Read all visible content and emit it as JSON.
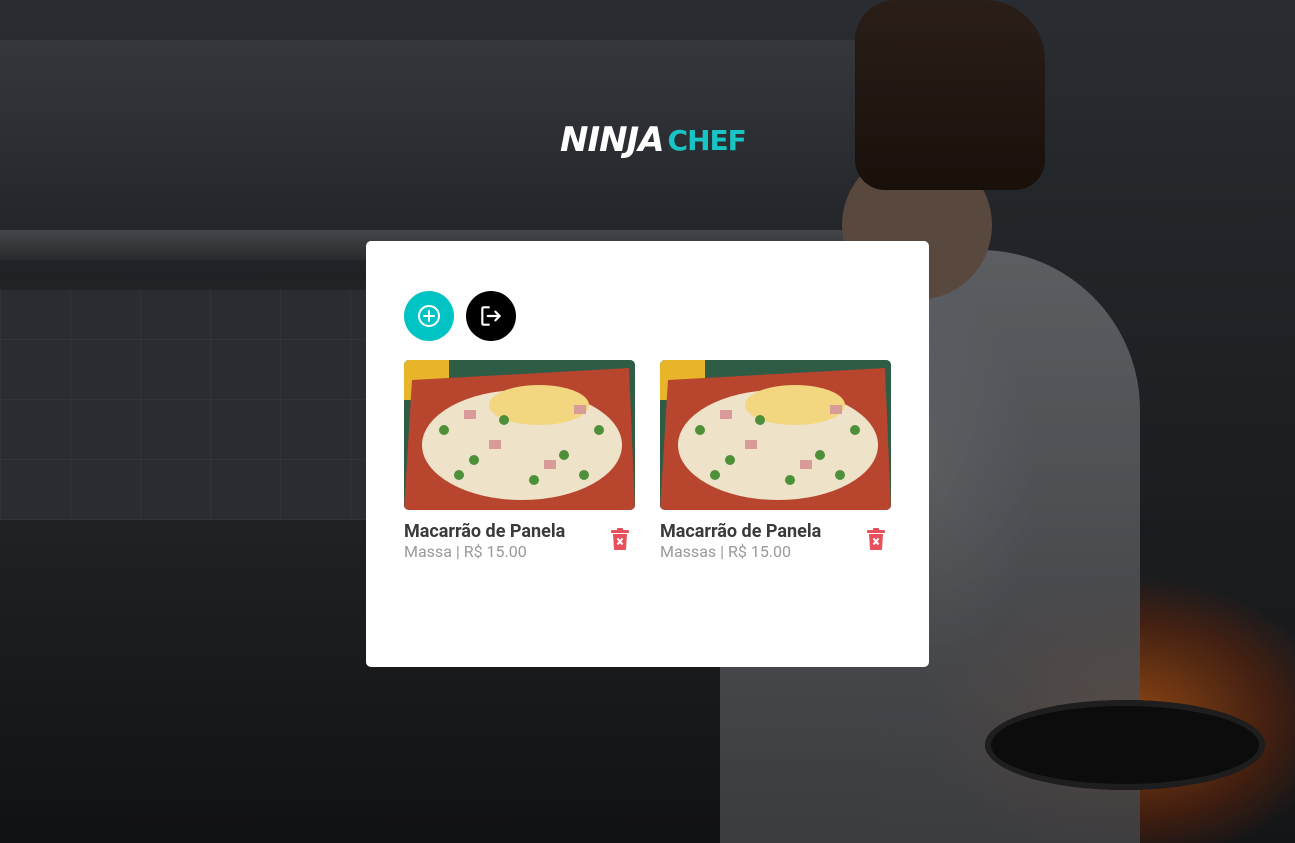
{
  "brand": {
    "part1": "NINJA",
    "part2": "CHEF",
    "accent_color": "#00c4c4"
  },
  "actions": {
    "add_icon": "plus-circle-icon",
    "logout_icon": "logout-icon"
  },
  "dishes": [
    {
      "name": "Macarrão de Panela",
      "category": "Massa",
      "price": "R$ 15.00",
      "image": "pasta-dish-image",
      "delete_icon": "trash-icon"
    },
    {
      "name": "Macarrão de Panela",
      "category": "Massas",
      "price": "R$ 15.00",
      "image": "pasta-dish-image",
      "delete_icon": "trash-icon"
    }
  ],
  "colors": {
    "delete": "#e8505b",
    "text": "#3a3a3a",
    "muted": "#999999"
  }
}
